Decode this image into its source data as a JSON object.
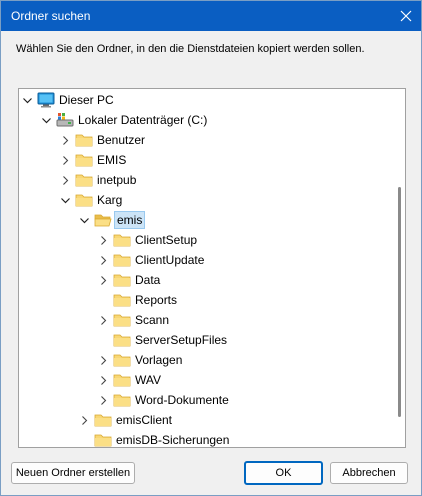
{
  "window": {
    "title": "Ordner suchen"
  },
  "dialog": {
    "description": "Wählen Sie den Ordner, in den die Dienstdateien kopiert werden sollen."
  },
  "tree": {
    "items": [
      {
        "label": "Dieser PC",
        "icon": "computer-icon",
        "expander": "expanded"
      },
      {
        "label": "Lokaler Datenträger (C:)",
        "icon": "drive-icon",
        "expander": "expanded"
      },
      {
        "label": "Benutzer",
        "icon": "folder-icon",
        "expander": "collapsed"
      },
      {
        "label": "EMIS",
        "icon": "folder-icon",
        "expander": "collapsed"
      },
      {
        "label": "inetpub",
        "icon": "folder-icon",
        "expander": "collapsed"
      },
      {
        "label": "Karg",
        "icon": "folder-icon",
        "expander": "expanded"
      },
      {
        "label": "emis",
        "icon": "folder-open-icon",
        "expander": "expanded",
        "selected": true
      },
      {
        "label": "ClientSetup",
        "icon": "folder-icon",
        "expander": "collapsed"
      },
      {
        "label": "ClientUpdate",
        "icon": "folder-icon",
        "expander": "collapsed"
      },
      {
        "label": "Data",
        "icon": "folder-icon",
        "expander": "collapsed"
      },
      {
        "label": "Reports",
        "icon": "folder-icon",
        "expander": "none"
      },
      {
        "label": "Scann",
        "icon": "folder-icon",
        "expander": "collapsed"
      },
      {
        "label": "ServerSetupFiles",
        "icon": "folder-icon",
        "expander": "none"
      },
      {
        "label": "Vorlagen",
        "icon": "folder-icon",
        "expander": "collapsed"
      },
      {
        "label": "WAV",
        "icon": "folder-icon",
        "expander": "collapsed"
      },
      {
        "label": "Word-Dokumente",
        "icon": "folder-icon",
        "expander": "collapsed"
      },
      {
        "label": "emisClient",
        "icon": "folder-icon",
        "expander": "collapsed"
      },
      {
        "label": "emisDB-Sicherungen",
        "icon": "folder-icon",
        "expander": "none"
      }
    ]
  },
  "buttons": {
    "new_folder": "Neuen Ordner erstellen",
    "ok": "OK",
    "cancel": "Abbrechen"
  },
  "colors": {
    "titlebar": "#0a5ec2",
    "folder": "#f8d775",
    "selection": "#cce4f7",
    "accent": "#0067c0"
  }
}
